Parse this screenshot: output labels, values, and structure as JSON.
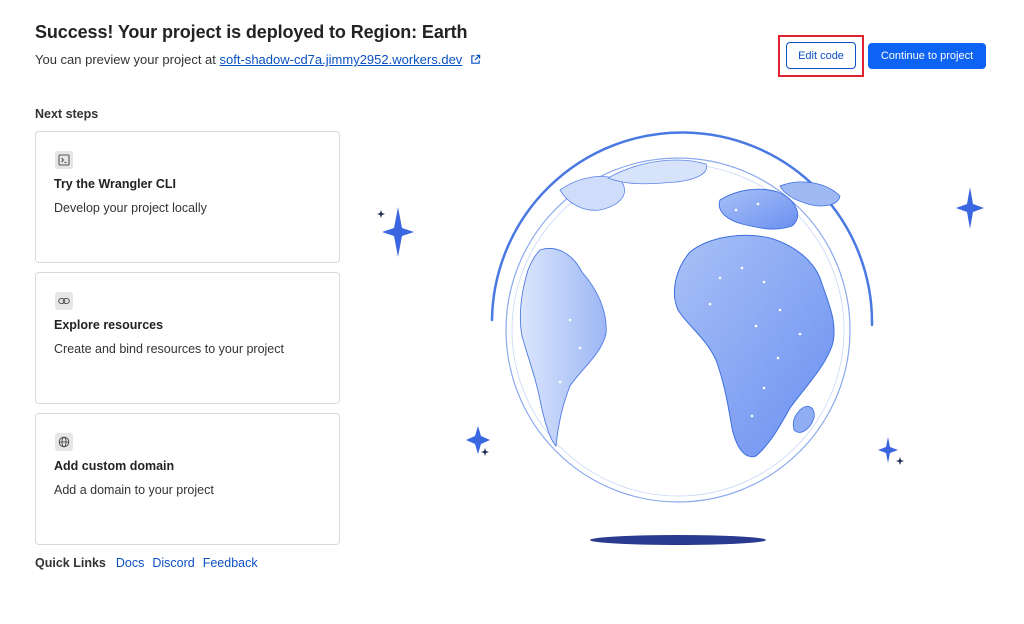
{
  "header": {
    "title": "Success! Your project is deployed to Region: Earth",
    "preview_prefix": "You can preview your project at",
    "preview_link": "soft-shadow-cd7a.jimmy2952.workers.dev"
  },
  "actions": {
    "edit_code_label": "Edit code",
    "continue_label": "Continue to project"
  },
  "next_steps": {
    "heading": "Next steps",
    "cards": [
      {
        "icon": "terminal-icon",
        "title": "Try the Wrangler CLI",
        "description": "Develop your project locally"
      },
      {
        "icon": "link-icon",
        "title": "Explore resources",
        "description": "Create and bind resources to your project"
      },
      {
        "icon": "globe-icon",
        "title": "Add custom domain",
        "description": "Add a domain to your project"
      }
    ]
  },
  "quick_links": {
    "label": "Quick Links",
    "items": [
      "Docs",
      "Discord",
      "Feedback"
    ]
  },
  "colors": {
    "accent": "#0d63f3",
    "link": "#0a51c4",
    "highlight": "#e0232e",
    "globe_land": "#7b9ef0",
    "globe_stroke": "#3d6fe0"
  }
}
